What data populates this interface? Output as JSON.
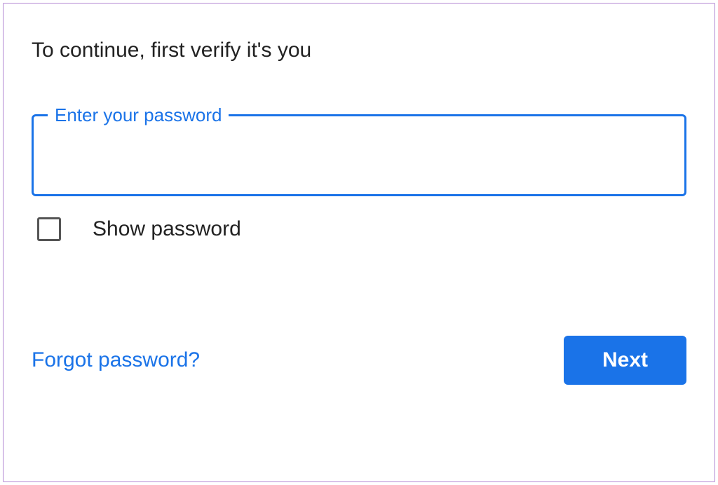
{
  "heading": "To continue, first verify it's you",
  "password_field": {
    "label": "Enter your password",
    "value": ""
  },
  "show_password": {
    "label": "Show password",
    "checked": false
  },
  "forgot_link": "Forgot password?",
  "next_button": "Next",
  "colors": {
    "primary": "#1a73e8",
    "frame_border": "#b388d4",
    "text": "#222"
  }
}
